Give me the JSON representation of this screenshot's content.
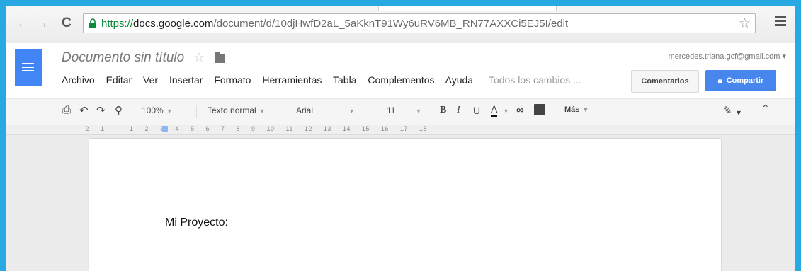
{
  "browser": {
    "url_scheme": "https://",
    "url_host": "docs.google.com",
    "url_path": "/document/d/10djHwfD2aL_5aKknT91Wy6uRV6MB_RN77AXXCi5EJ5I/edit"
  },
  "docs": {
    "title": "Documento sin título",
    "account": "mercedes.triana.gcf@gmail.com ▾",
    "menu": [
      "Archivo",
      "Editar",
      "Ver",
      "Insertar",
      "Formato",
      "Herramientas",
      "Tabla",
      "Complementos",
      "Ayuda"
    ],
    "save_status": "Todos los cambios ...",
    "comments_label": "Comentarios",
    "share_label": "Compartir"
  },
  "toolbar": {
    "zoom": "100%",
    "style": "Texto normal",
    "font": "Arial",
    "size": "11",
    "bold": "B",
    "italic": "I",
    "underline": "U",
    "text_color": "A",
    "more": "Más"
  },
  "ruler": {
    "text": "· 2 · · 1 · · · · · 1 · · 2 · · 3 · · 4 · · 5 · · 6 · · 7 · · 8 · · 9 · · 10 · · 11 · · 12 · · 13 · · 14 · · 15 · · 16 · · 17 · · 18 ·"
  },
  "document": {
    "body_text": "Mi Proyecto:"
  }
}
